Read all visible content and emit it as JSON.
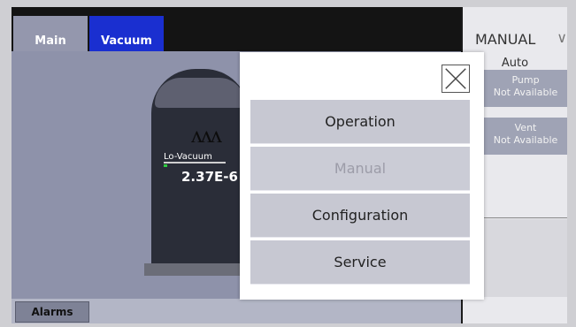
{
  "tabs": {
    "main": "Main",
    "vacuum": "Vacuum"
  },
  "gauge": {
    "label": "Lo-Vacuum",
    "value": "2.37E-6"
  },
  "alarms_label": "Alarms",
  "mode_panel": {
    "mode": "MANUAL",
    "auto_label": "Auto",
    "pump": {
      "title": "Pump",
      "status": "Not Available"
    },
    "vent": {
      "title": "Vent",
      "status": "Not Available"
    }
  },
  "menu": {
    "items": [
      "Operation",
      "Manual",
      "Configuration",
      "Service"
    ],
    "disabled_item": "Manual"
  },
  "icons": {
    "close": "close-icon",
    "mode_dropdown": "chevron-down-icon",
    "chamber": "vacuum-chamber-icon"
  },
  "colors": {
    "vacuum_tab": "#1a2fd0",
    "status_green": "#2ecc40"
  }
}
